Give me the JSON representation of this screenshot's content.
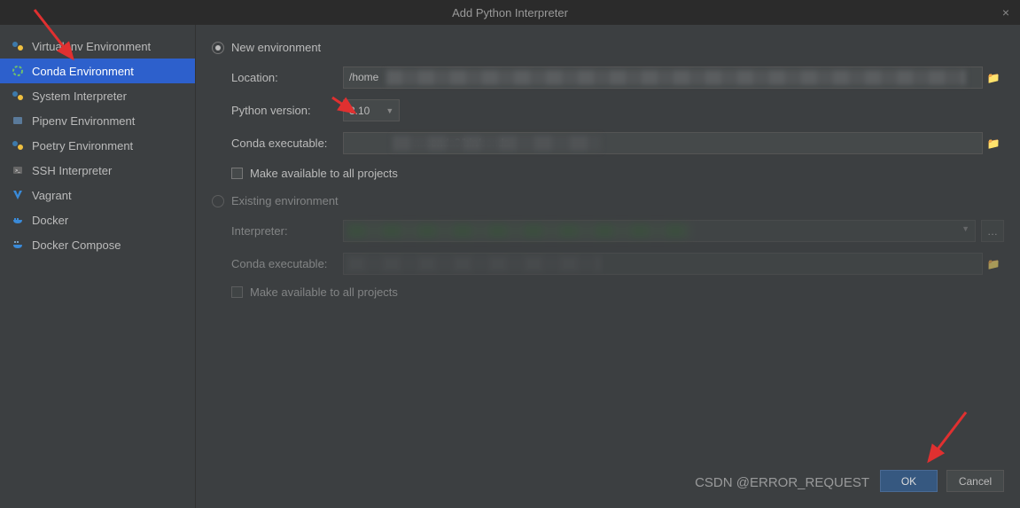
{
  "dialog": {
    "title": "Add Python Interpreter"
  },
  "sidebar": {
    "items": [
      {
        "label": "Virtualenv Environment",
        "icon": "python"
      },
      {
        "label": "Conda Environment",
        "icon": "conda"
      },
      {
        "label": "System Interpreter",
        "icon": "python"
      },
      {
        "label": "Pipenv Environment",
        "icon": "pipenv"
      },
      {
        "label": "Poetry Environment",
        "icon": "python"
      },
      {
        "label": "SSH Interpreter",
        "icon": "ssh"
      },
      {
        "label": "Vagrant",
        "icon": "vagrant"
      },
      {
        "label": "Docker",
        "icon": "docker"
      },
      {
        "label": "Docker Compose",
        "icon": "docker-compose"
      }
    ],
    "selected_index": 1
  },
  "form": {
    "new_env": {
      "radio": "New environment",
      "location_label": "Location:",
      "location_value": "/home",
      "python_version_label": "Python version:",
      "python_version_value": "3.10",
      "conda_exec_label": "Conda executable:",
      "conda_exec_value": "naconda3/bin/conda",
      "make_available_label": "Make available to all projects"
    },
    "existing_env": {
      "radio": "Existing environment",
      "interpreter_label": "Interpreter:",
      "conda_exec_label": "Conda executable:",
      "make_available_label": "Make available to all projects"
    }
  },
  "buttons": {
    "ok": "OK",
    "cancel": "Cancel"
  },
  "watermark": "CSDN @ERROR_REQUEST"
}
